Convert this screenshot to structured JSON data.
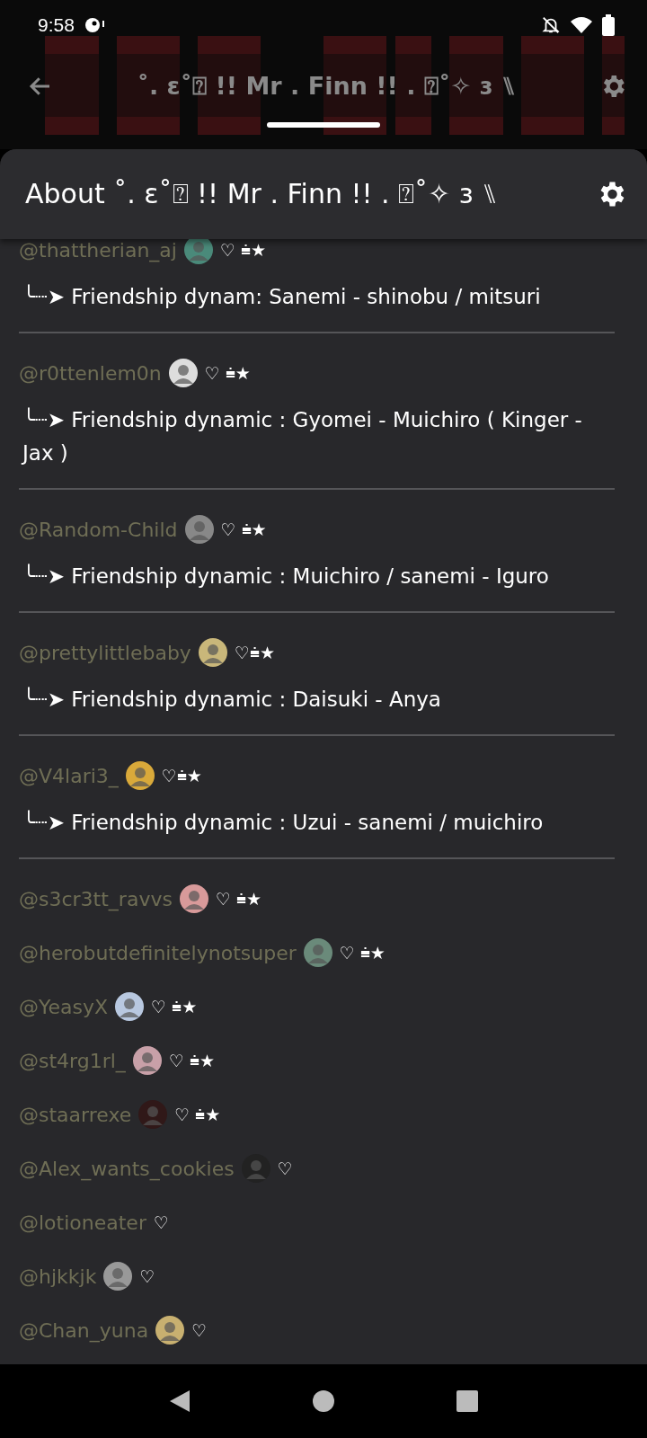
{
  "status_bar": {
    "time": "9:58"
  },
  "toolbar": {
    "title": "˚. ɛ˚⍰ !! Mr . Finn !! . ⍰˚✧ ɜ ⑊"
  },
  "sheet": {
    "title": "About ˚. ɛ˚⍰ !! Mr . Finn !! . ⍰˚✧ ɜ ⑊"
  },
  "members": [
    {
      "handle": "@thattherian_aj",
      "avatar": true,
      "badge": "♡  ⩧★",
      "dynamic": "╰┈➤ Friendship dynam: Sanemi - shinobu / mitsuri"
    },
    {
      "handle": "@r0ttenlem0n",
      "avatar": true,
      "badge": "♡ ⩧★",
      "dynamic": "╰┈➤ Friendship dynamic : Gyomei - Muichiro ( Kinger - Jax )"
    },
    {
      "handle": "@Random-Child",
      "avatar": true,
      "badge": "♡ ⩧★",
      "dynamic": "╰┈➤ Friendship dynamic : Muichiro / sanemi - Iguro"
    },
    {
      "handle": "@prettylittlebaby",
      "avatar": true,
      "badge": "♡⩧★",
      "dynamic": "╰┈➤ Friendship dynamic : Daisuki - Anya"
    },
    {
      "handle": "@V4lari3_",
      "avatar": true,
      "badge": "♡⩧★",
      "dynamic": "╰┈➤ Friendship dynamic : Uzui - sanemi / muichiro"
    },
    {
      "handle": "@s3cr3tt_ravvs",
      "avatar": true,
      "badge": "♡ ⩧★"
    },
    {
      "handle": "@herobutdefinitelynotsuper",
      "avatar": true,
      "badge": "♡ ⩧★"
    },
    {
      "handle": "@YeasyX",
      "avatar": true,
      "badge": "♡ ⩧★"
    },
    {
      "handle": "@st4rg1rl_",
      "avatar": true,
      "badge": "♡ ⩧★"
    },
    {
      "handle": "@staarrexe",
      "avatar": true,
      "badge": "♡ ⩧★"
    },
    {
      "handle": "@Alex_wants_cookies",
      "avatar": true,
      "badge": "♡"
    },
    {
      "handle": "@lotioneater",
      "avatar": false,
      "badge": "♡"
    },
    {
      "handle": "@hjkkjk",
      "avatar": true,
      "badge": "♡"
    },
    {
      "handle": "@Chan_yuna",
      "avatar": true,
      "badge": "♡"
    }
  ]
}
